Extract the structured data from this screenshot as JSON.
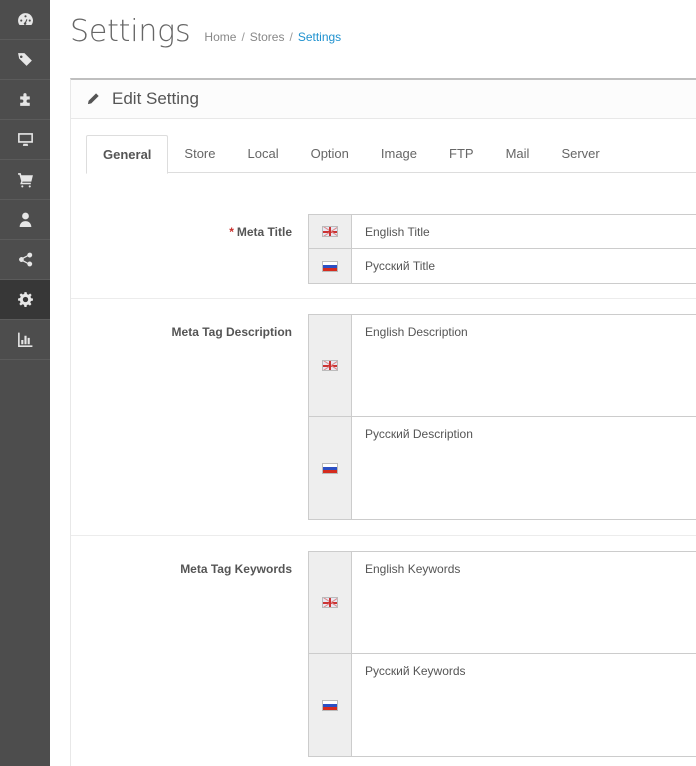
{
  "sidebar": {
    "items": [
      {
        "icon": "dashboard-icon"
      },
      {
        "icon": "tags-icon"
      },
      {
        "icon": "puzzle-icon"
      },
      {
        "icon": "desktop-icon"
      },
      {
        "icon": "shopping-cart-icon"
      },
      {
        "icon": "user-icon"
      },
      {
        "icon": "share-icon"
      },
      {
        "icon": "gear-icon",
        "active": true
      },
      {
        "icon": "bar-chart-icon"
      }
    ]
  },
  "header": {
    "title": "Settings",
    "breadcrumb": [
      "Home",
      "Stores",
      "Settings"
    ]
  },
  "panel": {
    "title": "Edit Setting",
    "tabs": [
      "General",
      "Store",
      "Local",
      "Option",
      "Image",
      "FTP",
      "Mail",
      "Server"
    ],
    "active_tab": "General"
  },
  "form": {
    "meta_title": {
      "label": "Meta Title",
      "required_mark": "*",
      "en_value": "English Title",
      "ru_value": "Русский Title"
    },
    "meta_description": {
      "label": "Meta Tag Description",
      "en_value": "English Description",
      "ru_value": "Русский Description"
    },
    "meta_keywords": {
      "label": "Meta Tag Keywords",
      "en_value": "English Keywords",
      "ru_value": "Русский Keywords"
    }
  },
  "colors": {
    "sidebar_bg": "#4d4d4d",
    "accent": "#1e91cf",
    "required": "#c9302c"
  }
}
